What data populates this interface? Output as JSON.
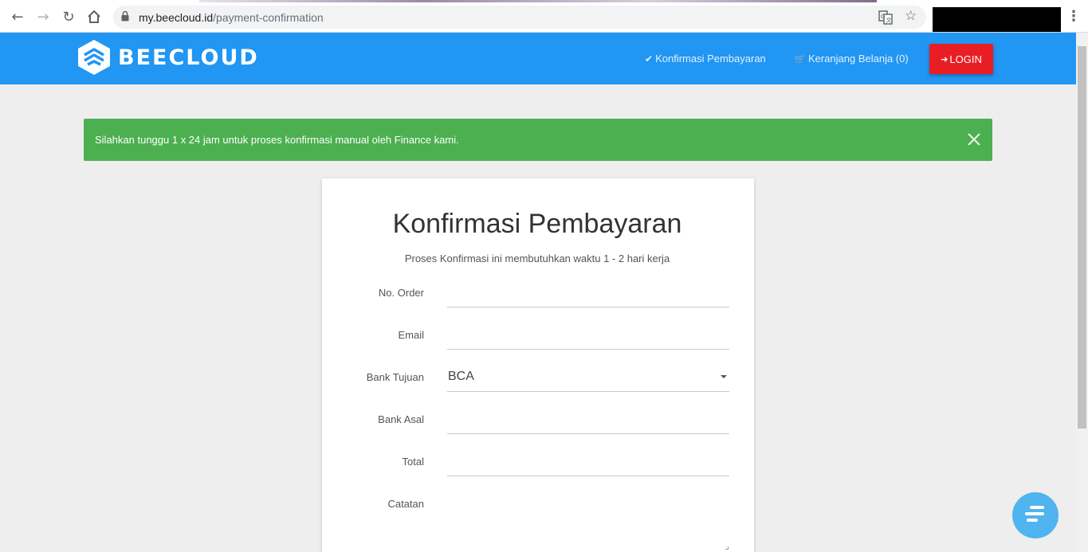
{
  "browser": {
    "url_host": "my.beecloud.id",
    "url_path": "/payment-confirmation",
    "icons": [
      "back-arrow-icon",
      "forward-arrow-icon",
      "reload-icon",
      "home-icon",
      "lock-icon",
      "translate-icon",
      "bookmark-star-icon",
      "menu-kebab-icon"
    ]
  },
  "header": {
    "brand": "BEECLOUD",
    "nav": [
      {
        "label": "Konfirmasi Pembayaran",
        "icon": "checkmark-icon"
      },
      {
        "label": "Keranjang Belanja (0)",
        "icon": "cart-icon"
      }
    ],
    "login_label": "LOGIN",
    "login_icon": "sign-in-icon"
  },
  "alert": {
    "message": "Silahkan tunggu 1 x 24 jam untuk proses konfirmasi manual oleh Finance kami."
  },
  "form": {
    "title": "Konfirmasi Pembayaran",
    "subtitle": "Proses Konfirmasi ini membutuhkan waktu 1 - 2 hari kerja",
    "fields": [
      {
        "label": "No. Order",
        "value": ""
      },
      {
        "label": "Email",
        "value": ""
      },
      {
        "label": "Bank Tujuan",
        "value": "BCA"
      },
      {
        "label": "Bank Asal",
        "value": ""
      },
      {
        "label": "Total",
        "value": ""
      },
      {
        "label": "Catatan",
        "value": ""
      }
    ]
  },
  "colors": {
    "header_blue": "#2196f3",
    "login_red": "#e91e25",
    "alert_green": "#4caf50",
    "chat_blue": "#4fb4ef",
    "page_bg": "#eeeeee"
  }
}
